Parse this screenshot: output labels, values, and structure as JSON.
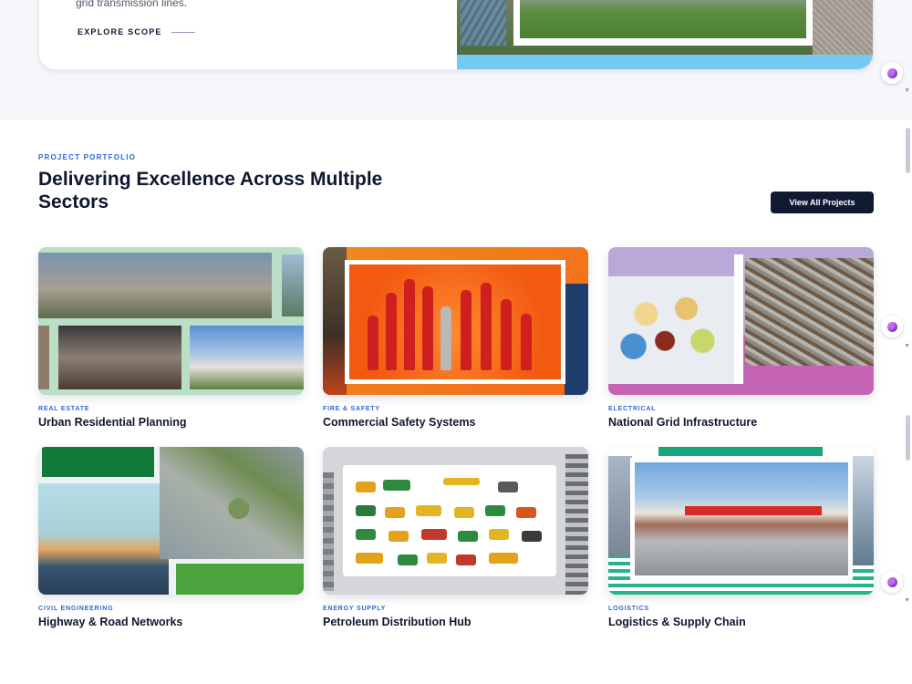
{
  "scope": {
    "description_tail": "grid transmission lines.",
    "explore_label": "EXPLORE SCOPE"
  },
  "portfolio": {
    "eyebrow": "PROJECT PORTFOLIO",
    "title": "Delivering Excellence Across Multiple Sectors",
    "view_all_label": "View All Projects",
    "projects": [
      {
        "category": "REAL ESTATE",
        "title": "Urban Residential Planning"
      },
      {
        "category": "FIRE & SAFETY",
        "title": "Commercial Safety Systems"
      },
      {
        "category": "ELECTRICAL",
        "title": "National Grid Infrastructure"
      },
      {
        "category": "CIVIL ENGINEERING",
        "title": "Highway & Road Networks"
      },
      {
        "category": "ENERGY SUPPLY",
        "title": "Petroleum Distribution Hub"
      },
      {
        "category": "LOGISTICS",
        "title": "Logistics & Supply Chain"
      }
    ]
  },
  "colors": {
    "accent": "#2f64d6",
    "heading": "#0f1730",
    "button_bg": "#111a33",
    "band_bg": "#f6f7fa"
  },
  "icons": [
    "arrow-line-icon",
    "assistant-orb-icon",
    "caret-down-icon"
  ]
}
